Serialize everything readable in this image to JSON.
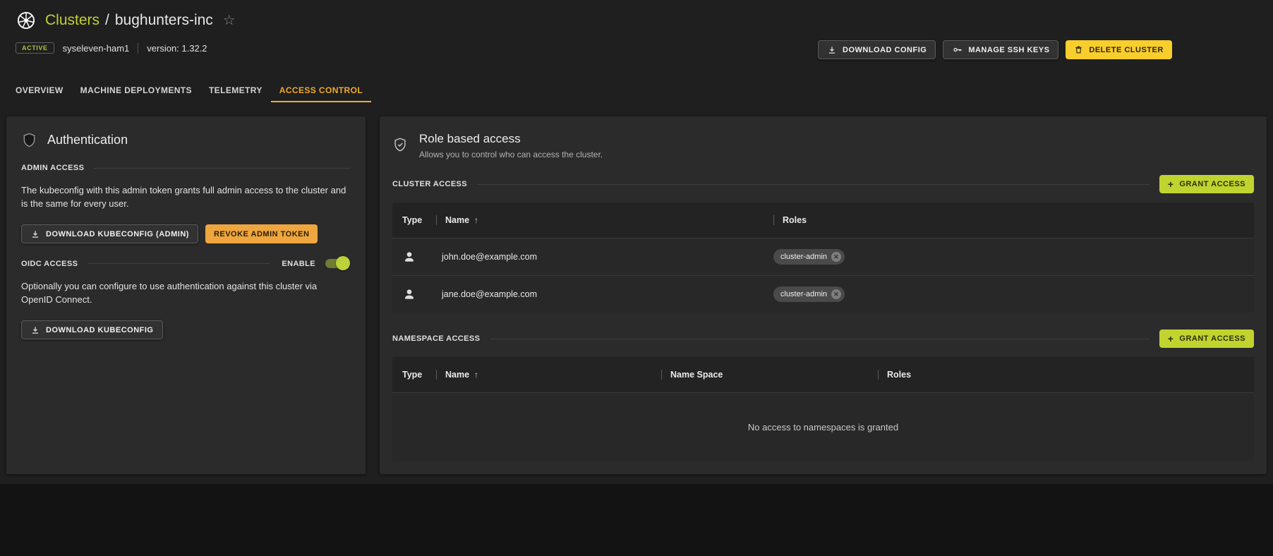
{
  "header": {
    "breadcrumb": {
      "section": "Clusters",
      "separator": "/",
      "cluster": "bughunters-inc"
    },
    "status_badge": "ACTIVE",
    "datacenter": "syseleven-ham1",
    "version": "version: 1.32.2",
    "actions": {
      "download_config": "DOWNLOAD CONFIG",
      "manage_ssh_keys": "MANAGE SSH KEYS",
      "delete_cluster": "DELETE CLUSTER"
    }
  },
  "tabs": [
    {
      "label": "OVERVIEW",
      "active": false
    },
    {
      "label": "MACHINE DEPLOYMENTS",
      "active": false
    },
    {
      "label": "TELEMETRY",
      "active": false
    },
    {
      "label": "ACCESS CONTROL",
      "active": true
    }
  ],
  "authentication": {
    "title": "Authentication",
    "admin_access": {
      "label": "ADMIN ACCESS",
      "description": "The kubeconfig with this admin token grants full admin access to the cluster and is the same for every user.",
      "download_button": "DOWNLOAD KUBECONFIG (ADMIN)",
      "revoke_button": "REVOKE ADMIN TOKEN"
    },
    "oidc_access": {
      "label": "OIDC ACCESS",
      "enable_label": "ENABLE",
      "enabled": true,
      "description": "Optionally you can configure to use authentication against this cluster via OpenID Connect.",
      "download_button": "DOWNLOAD KUBECONFIG"
    }
  },
  "rbac": {
    "title": "Role based access",
    "subtitle": "Allows you to control who can access the cluster.",
    "cluster_access": {
      "label": "CLUSTER ACCESS",
      "grant_button": "GRANT ACCESS",
      "columns": [
        "Type",
        "Name",
        "Roles"
      ],
      "rows": [
        {
          "type": "user",
          "name": "john.doe@example.com",
          "roles": [
            "cluster-admin"
          ]
        },
        {
          "type": "user",
          "name": "jane.doe@example.com",
          "roles": [
            "cluster-admin"
          ]
        }
      ]
    },
    "namespace_access": {
      "label": "NAMESPACE ACCESS",
      "grant_button": "GRANT ACCESS",
      "columns": [
        "Type",
        "Name",
        "Name Space",
        "Roles"
      ],
      "empty_message": "No access to namespaces is granted"
    }
  },
  "icons": {
    "star": "☆",
    "sort_asc": "↑",
    "plus": "+",
    "close": "✕"
  },
  "colors": {
    "accent_lime": "#c1d32f",
    "accent_amber": "#efa63e",
    "accent_yellow": "#f8ce2d",
    "tab_active": "#f1a92b",
    "status_active": "#a8c63c",
    "panel_bg": "#2b2b2b",
    "page_bg": "#1f1f1f"
  }
}
